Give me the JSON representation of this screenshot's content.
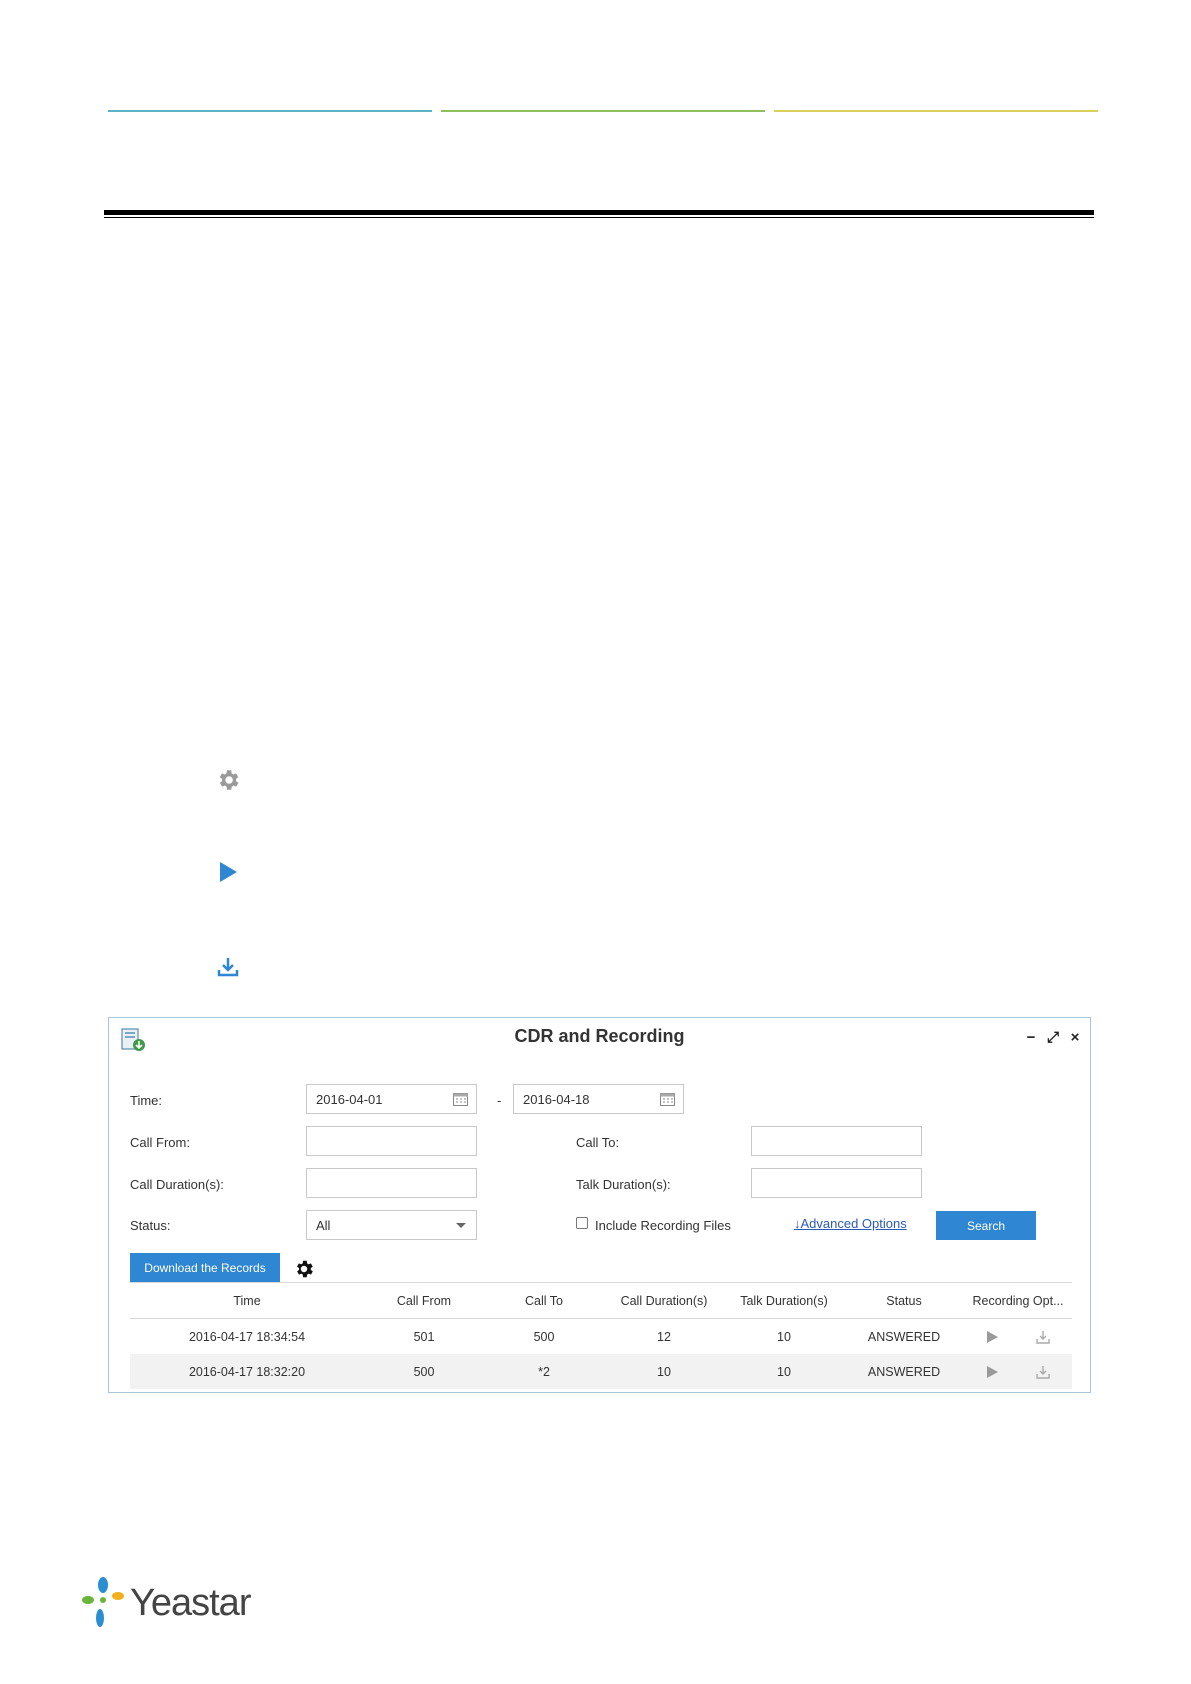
{
  "page": {
    "footer_brand": "Yeastar"
  },
  "side_icons": {
    "gear": "gear-icon",
    "play": "play-icon",
    "download": "download-icon"
  },
  "window": {
    "title": "CDR and Recording",
    "controls": {
      "minimize": "−",
      "maximize": "⤢",
      "close": "×"
    },
    "form": {
      "time_label": "Time:",
      "time_from": "2016-04-01",
      "time_sep": "-",
      "time_to": "2016-04-18",
      "call_from_label": "Call From:",
      "call_from_value": "",
      "call_to_label": "Call To:",
      "call_to_value": "",
      "call_duration_label": "Call Duration(s):",
      "call_duration_value": "",
      "talk_duration_label": "Talk Duration(s):",
      "talk_duration_value": "",
      "status_label": "Status:",
      "status_value": "All",
      "include_recording_label": "Include Recording Files",
      "include_recording_checked": false,
      "advanced_options": "↓Advanced Options",
      "search_button": "Search"
    },
    "download_button": "Download the Records",
    "table": {
      "headers": [
        "Time",
        "Call From",
        "Call To",
        "Call Duration(s)",
        "Talk Duration(s)",
        "Status",
        "Recording Opt..."
      ],
      "rows": [
        [
          "2016-04-17 18:34:54",
          "501",
          "500",
          "12",
          "10",
          "ANSWERED"
        ],
        [
          "2016-04-17 18:32:20",
          "500",
          "*2",
          "10",
          "10",
          "ANSWERED"
        ]
      ]
    }
  },
  "colors": {
    "accent": "#2f86d3",
    "header_line_1": "#5bb3c4",
    "header_line_2": "#8fbf5a",
    "header_line_3": "#d9cf5a"
  }
}
